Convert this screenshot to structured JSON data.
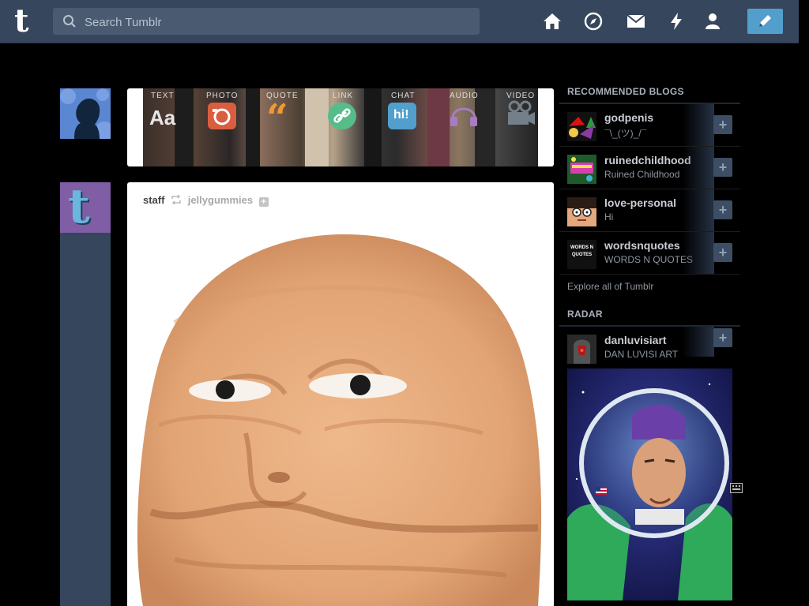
{
  "header": {
    "logo": "t",
    "search_placeholder": "Search Tumblr",
    "nav": [
      "home-icon",
      "explore-icon",
      "inbox-icon",
      "activity-icon",
      "account-icon"
    ],
    "compose_icon": "pencil-icon"
  },
  "post_form": {
    "items": [
      {
        "label": "TEXT",
        "icon": "Aa"
      },
      {
        "label": "PHOTO",
        "icon": "camera"
      },
      {
        "label": "QUOTE",
        "icon": "“"
      },
      {
        "label": "LINK",
        "icon": "link"
      },
      {
        "label": "CHAT",
        "icon": "hi!"
      },
      {
        "label": "AUDIO",
        "icon": "headphones"
      },
      {
        "label": "VIDEO",
        "icon": "video-camera"
      }
    ]
  },
  "post": {
    "author": "staff",
    "reblog_icon": "reblog-icon",
    "reblogged_from": "jellygummies",
    "follow": "+"
  },
  "sidebar": {
    "recommended_title": "RECOMMENDED BLOGS",
    "blogs": [
      {
        "name": "godpenis",
        "title": "¯\\_(ツ)_/¯"
      },
      {
        "name": "ruinedchildhood",
        "title": "Ruined Childhood"
      },
      {
        "name": "love-personal",
        "title": "Hi"
      },
      {
        "name": "wordsnquotes",
        "title": "WORDS N QUOTES"
      }
    ],
    "follow_label": "+",
    "explore": "Explore all of Tumblr",
    "radar_title": "RADAR",
    "radar_blog": {
      "name": "danluvisiart",
      "title": "DAN LUVISI ART"
    },
    "words_avatar_text": "WORDS N QUOTES"
  },
  "colors": {
    "header_bg": "#36465d",
    "compose_bg": "#529ecc",
    "page_bg": "#000000"
  }
}
